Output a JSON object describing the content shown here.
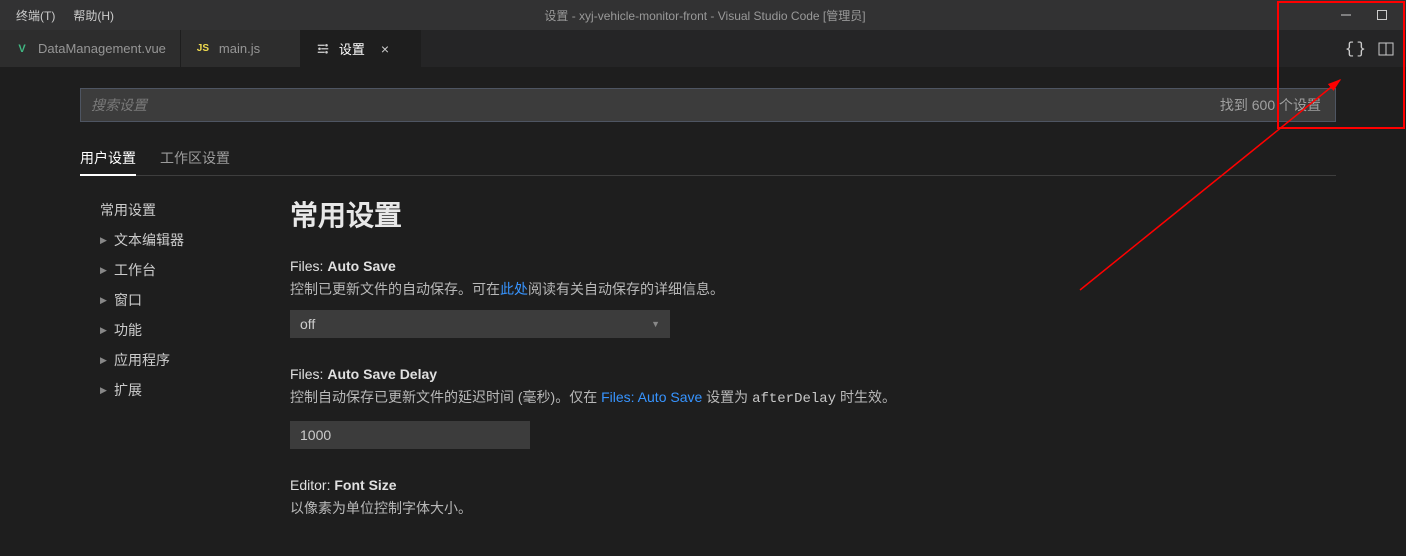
{
  "menu": {
    "terminal": "终端(T)",
    "help": "帮助(H)"
  },
  "titleBar": "设置 - xyj-vehicle-monitor-front - Visual Studio Code [管理员]",
  "tabs": {
    "t1": "DataManagement.vue",
    "t2": "main.js",
    "t3": "设置"
  },
  "search": {
    "placeholder": "搜索设置",
    "count": "找到 600 个设置"
  },
  "settingsTabs": {
    "user": "用户设置",
    "workspace": "工作区设置"
  },
  "sidebar": {
    "common": "常用设置",
    "textEditor": "文本编辑器",
    "workbench": "工作台",
    "window": "窗口",
    "features": "功能",
    "application": "应用程序",
    "extensions": "扩展"
  },
  "section": {
    "title": "常用设置"
  },
  "settings": {
    "autoSave": {
      "label_prefix": "Files: ",
      "label_bold": "Auto Save",
      "desc_a": "控制已更新文件的自动保存。可在",
      "desc_link": "此处",
      "desc_b": "阅读有关自动保存的详细信息。",
      "value": "off"
    },
    "autoSaveDelay": {
      "label_prefix": "Files: ",
      "label_bold": "Auto Save Delay",
      "desc_a": "控制自动保存已更新文件的延迟时间 (毫秒)。仅在 ",
      "desc_link": "Files: Auto Save",
      "desc_b": " 设置为 ",
      "desc_code": "afterDelay",
      "desc_c": " 时生效。",
      "value": "1000"
    },
    "fontSize": {
      "label_prefix": "Editor: ",
      "label_bold": "Font Size",
      "desc": "以像素为单位控制字体大小。"
    }
  }
}
